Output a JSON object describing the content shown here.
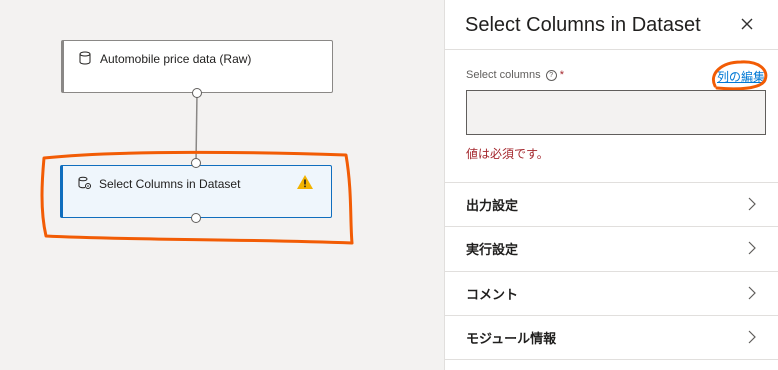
{
  "canvas": {
    "nodes": [
      {
        "title": "Automobile price data (Raw)",
        "icon": "dataset-icon"
      },
      {
        "title": "Select Columns in Dataset",
        "icon": "module-icon",
        "status_icon": "warning-icon"
      }
    ]
  },
  "panel": {
    "title": "Select Columns in Dataset",
    "close_icon": "close-icon",
    "field": {
      "label": "Select columns",
      "required_mark": "*",
      "help_icon": "?",
      "edit_link": "列の編集",
      "value": "",
      "error": "値は必須です。"
    },
    "sections": [
      {
        "label": "出力設定"
      },
      {
        "label": "実行設定"
      },
      {
        "label": "コメント"
      },
      {
        "label": "モジュール情報"
      }
    ]
  },
  "colors": {
    "accent": "#0078d4",
    "error": "#a4262c",
    "warning": "#f2b300",
    "annotation": "#f25c05"
  }
}
